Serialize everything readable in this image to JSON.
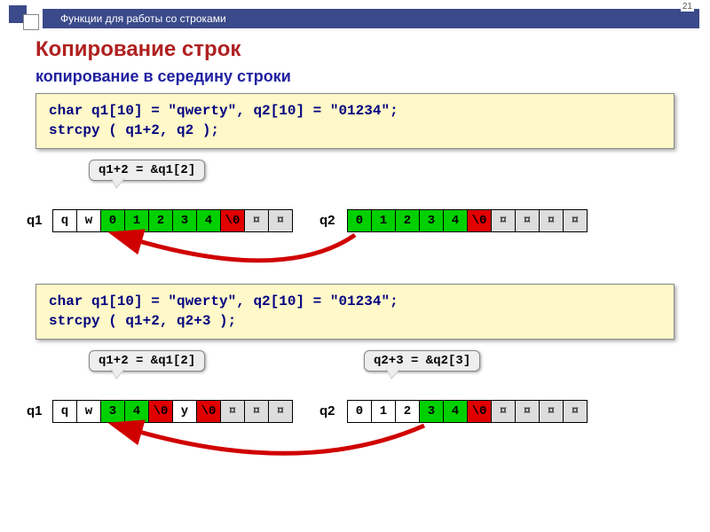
{
  "header": {
    "title": "Функции для работы со строками",
    "page": "21"
  },
  "h1": "Копирование строк",
  "h2": "копирование в середину строки",
  "code1": {
    "line1": "char q1[10] = \"qwerty\", q2[10] = \"01234\";",
    "line2": "strcpy ( q1+2, q2 );"
  },
  "code2": {
    "line1": "char q1[10] = \"qwerty\", q2[10] = \"01234\";",
    "line2": "strcpy ( q1+2, q2+3 );"
  },
  "callout1": "q1+2 = &q1[2]",
  "callout2": "q1+2 = &q1[2]",
  "callout3": "q2+3 = &q2[3]",
  "labels": {
    "q1": "q1",
    "q2": "q2"
  },
  "arrays": {
    "row1": {
      "q1": [
        {
          "v": "q",
          "c": ""
        },
        {
          "v": "w",
          "c": ""
        },
        {
          "v": "0",
          "c": "g"
        },
        {
          "v": "1",
          "c": "g"
        },
        {
          "v": "2",
          "c": "g"
        },
        {
          "v": "3",
          "c": "g"
        },
        {
          "v": "4",
          "c": "g"
        },
        {
          "v": "\\0",
          "c": "r"
        },
        {
          "v": "¤",
          "c": "x"
        },
        {
          "v": "¤",
          "c": "x"
        }
      ],
      "q2": [
        {
          "v": "0",
          "c": "g"
        },
        {
          "v": "1",
          "c": "g"
        },
        {
          "v": "2",
          "c": "g"
        },
        {
          "v": "3",
          "c": "g"
        },
        {
          "v": "4",
          "c": "g"
        },
        {
          "v": "\\0",
          "c": "r"
        },
        {
          "v": "¤",
          "c": "x"
        },
        {
          "v": "¤",
          "c": "x"
        },
        {
          "v": "¤",
          "c": "x"
        },
        {
          "v": "¤",
          "c": "x"
        }
      ]
    },
    "row2": {
      "q1": [
        {
          "v": "q",
          "c": ""
        },
        {
          "v": "w",
          "c": ""
        },
        {
          "v": "3",
          "c": "g"
        },
        {
          "v": "4",
          "c": "g"
        },
        {
          "v": "\\0",
          "c": "r"
        },
        {
          "v": "y",
          "c": ""
        },
        {
          "v": "\\0",
          "c": "r"
        },
        {
          "v": "¤",
          "c": "x"
        },
        {
          "v": "¤",
          "c": "x"
        },
        {
          "v": "¤",
          "c": "x"
        }
      ],
      "q2": [
        {
          "v": "0",
          "c": ""
        },
        {
          "v": "1",
          "c": ""
        },
        {
          "v": "2",
          "c": ""
        },
        {
          "v": "3",
          "c": "g"
        },
        {
          "v": "4",
          "c": "g"
        },
        {
          "v": "\\0",
          "c": "r"
        },
        {
          "v": "¤",
          "c": "x"
        },
        {
          "v": "¤",
          "c": "x"
        },
        {
          "v": "¤",
          "c": "x"
        },
        {
          "v": "¤",
          "c": "x"
        }
      ]
    }
  }
}
